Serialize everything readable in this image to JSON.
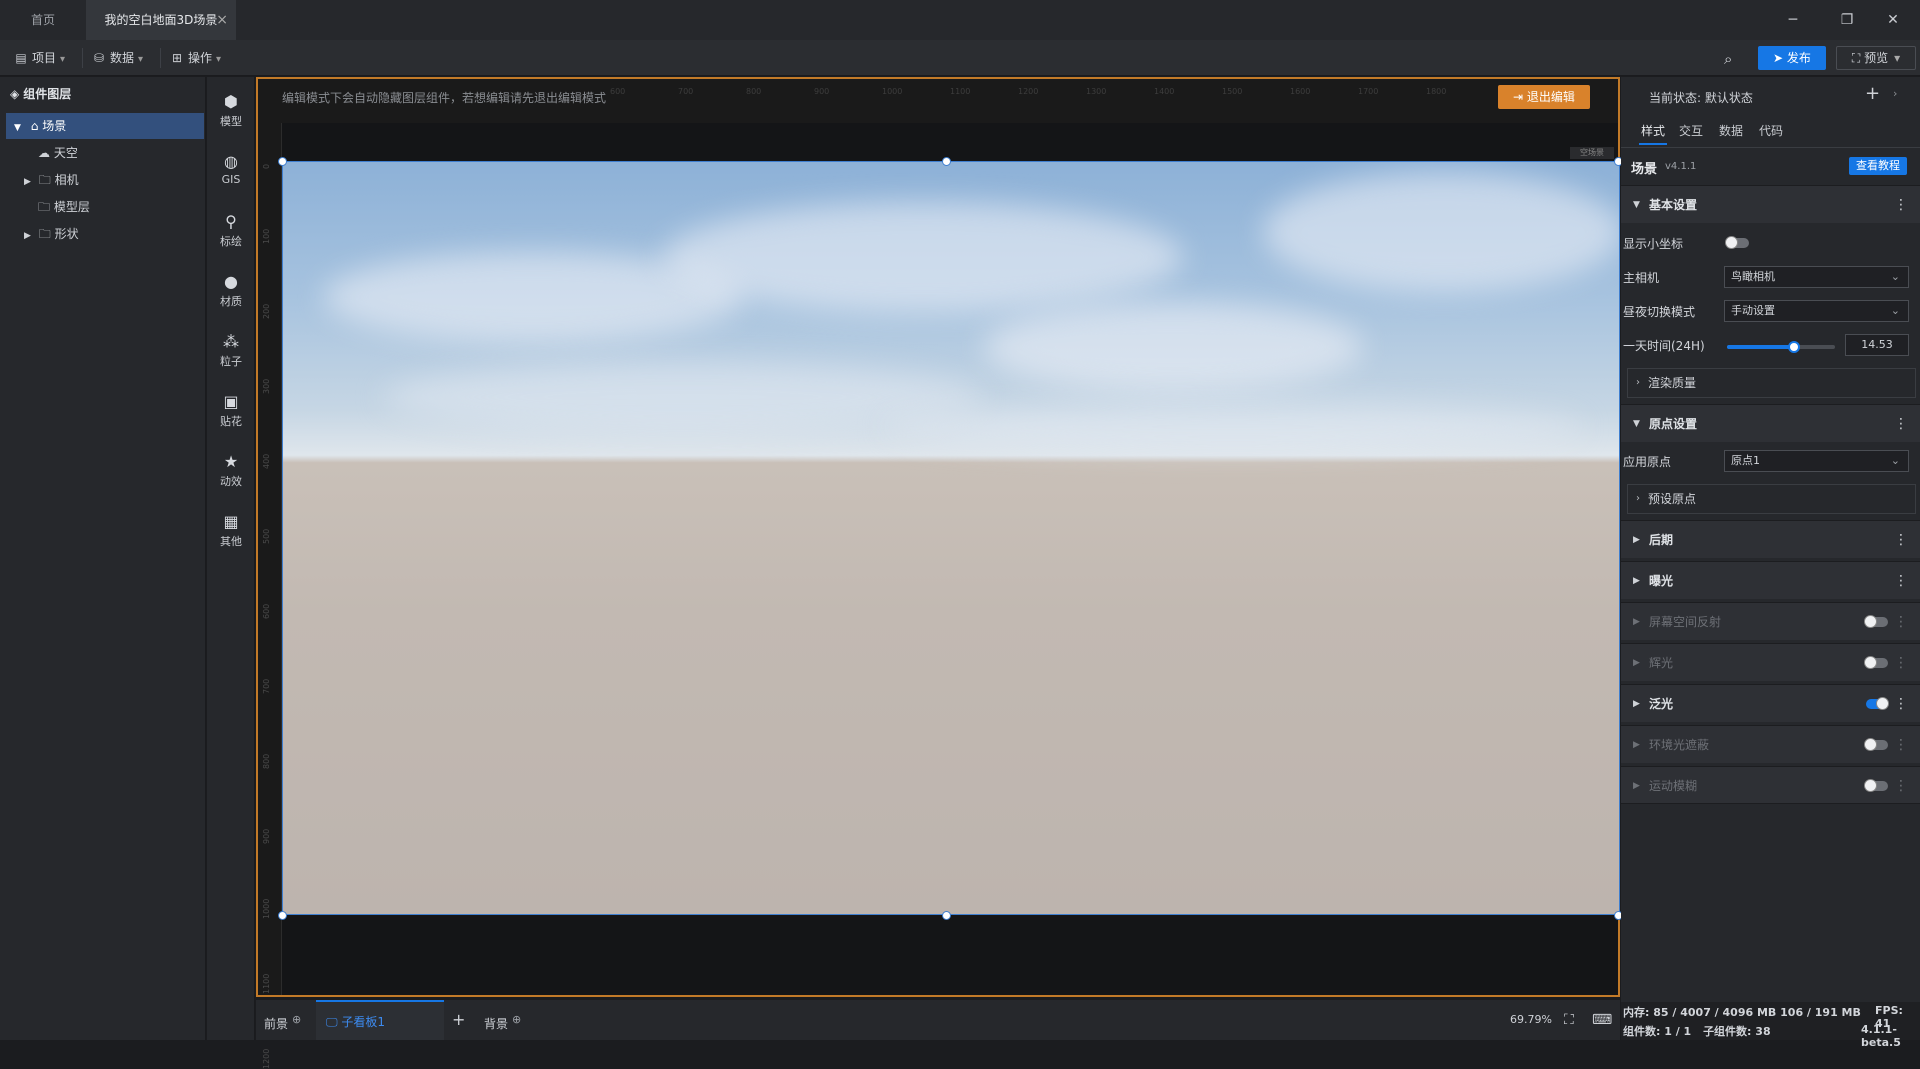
{
  "tabs": {
    "home": "首页",
    "active": "我的空白地面3D场景"
  },
  "window": {
    "minimize": "─",
    "restore": "❐",
    "close": "✕"
  },
  "menu": {
    "project": "项目",
    "data": "数据",
    "ops": "操作",
    "publish": "发布",
    "preview": "预览"
  },
  "layers": {
    "title": "组件图层",
    "items": [
      {
        "label": "场景",
        "icon": "scene-icon",
        "selected": true
      },
      {
        "label": "天空",
        "icon": "sky-icon"
      },
      {
        "label": "相机",
        "icon": "folder-icon"
      },
      {
        "label": "模型层",
        "icon": "folder-icon"
      },
      {
        "label": "形状",
        "icon": "folder-icon"
      }
    ]
  },
  "tools": [
    {
      "label": "模型",
      "icon": "model-icon"
    },
    {
      "label": "GIS",
      "icon": "globe-icon"
    },
    {
      "label": "标绘",
      "icon": "pin-icon"
    },
    {
      "label": "材质",
      "icon": "material-icon"
    },
    {
      "label": "粒子",
      "icon": "particle-icon"
    },
    {
      "label": "贴花",
      "icon": "decal-icon"
    },
    {
      "label": "动效",
      "icon": "effect-icon"
    },
    {
      "label": "其他",
      "icon": "grid-icon"
    }
  ],
  "canvas": {
    "note": "编辑模式下会自动隐藏图层组件，若想编辑请先退出编辑模式",
    "exit": "退出编辑",
    "tag": "空场景",
    "ruler_h": [
      "600",
      "700",
      "800",
      "900",
      "1000",
      "1100",
      "1200",
      "1300",
      "1400",
      "1500",
      "1600",
      "1700",
      "1800"
    ],
    "ruler_v": [
      "0",
      "100",
      "200",
      "300",
      "400",
      "500",
      "600",
      "700",
      "800",
      "900",
      "1000",
      "1100",
      "1200"
    ]
  },
  "bottom": {
    "front": "前景",
    "child": "子看板1",
    "back": "背景",
    "zoom": "69.79%"
  },
  "right": {
    "state_label": "当前状态:",
    "state_value": "默认状态",
    "tabs": [
      "样式",
      "交互",
      "数据",
      "代码"
    ],
    "comp_name": "场景",
    "version": "v4.1.1",
    "tutorial": "查看教程",
    "basic": "基本设置",
    "show_axis": "显示小坐标",
    "main_camera": "主相机",
    "main_camera_value": "鸟瞰相机",
    "daynight": "昼夜切换模式",
    "daynight_value": "手动设置",
    "time": "一天时间(24H)",
    "time_value": "14.53",
    "render_quality": "渲染质量",
    "origin": "原点设置",
    "apply_origin": "应用原点",
    "apply_origin_value": "原点1",
    "preset_origin": "预设原点",
    "post": "后期",
    "exposure": "曝光",
    "ssr": "屏幕空间反射",
    "glow": "辉光",
    "bloom": "泛光",
    "ao": "环境光遮蔽",
    "motion_blur": "运动模糊"
  },
  "status": {
    "mem_label": "内存:",
    "mem_value": "85 / 4007 / 4096 MB  106 / 191 MB",
    "fps_label": "FPS:",
    "fps_value": "41",
    "comp_count": "组件数: 1 / 1",
    "child_count": "子组件数: 38",
    "build": "4.1.1-beta.5"
  },
  "colors": {
    "accent": "#1677e5",
    "edit_border": "#c27a28",
    "exit_btn": "#d9822b"
  }
}
